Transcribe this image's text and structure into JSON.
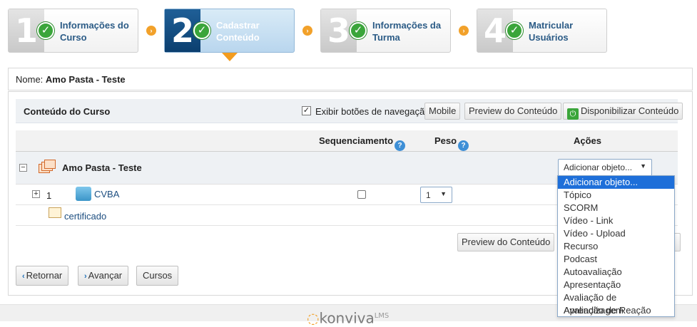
{
  "wizard": {
    "steps": [
      {
        "number": "1",
        "label": "Informações do Curso"
      },
      {
        "number": "2",
        "label": "Cadastrar Conteúdo"
      },
      {
        "number": "3",
        "label": "Informações da Turma"
      },
      {
        "number": "4",
        "label": "Matricular Usuários"
      }
    ],
    "check_glyph": "✓",
    "arrow_glyph": "›"
  },
  "name_bar": {
    "label": "Nome:",
    "value": "Amo Pasta - Teste"
  },
  "toolbar": {
    "title": "Conteúdo do Curso",
    "checkbox_label": "Exibir botões de navegação",
    "checkbox_glyph": "✓",
    "mobile_label": "Mobile",
    "preview_label": "Preview do Conteúdo",
    "publish_label": "Disponibilizar Conteúdo"
  },
  "table": {
    "headers": {
      "sequencing": "Sequenciamento",
      "weight": "Peso",
      "actions": "Ações"
    },
    "help_glyph": "?",
    "root": {
      "toggle": "−",
      "name": "Amo Pasta - Teste",
      "action_select": "Adicionar objeto..."
    },
    "rows": [
      {
        "toggle": "+",
        "order": "1",
        "name": "CVBA",
        "weight": "1"
      },
      {
        "name": "certificado"
      }
    ]
  },
  "dropdown": {
    "options": [
      "Adicionar objeto...",
      "Tópico",
      "SCORM",
      "Vídeo - Link",
      "Vídeo - Upload",
      "Recurso",
      "Podcast",
      "Autoavaliação",
      "Apresentação",
      "Avaliação de Aprendizagem",
      "Avaliação de Reação"
    ],
    "selected_index": 0
  },
  "bottom": {
    "preview_label": "Preview do Conteúdo",
    "back_label": "Retornar",
    "next_label": "Avançar",
    "courses_label": "Cursos",
    "back_glyph": "‹",
    "next_glyph": "›"
  },
  "footer": {
    "logo_text": "konviva",
    "logo_sup": "LMS"
  },
  "colors": {
    "accent": "#1f5f97",
    "success": "#3aa53a",
    "orange": "#f2a12a",
    "selected": "#1e6fd9"
  }
}
